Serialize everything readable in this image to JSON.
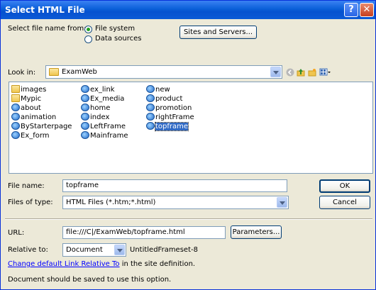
{
  "window": {
    "title": "Select HTML File",
    "help_glyph": "?",
    "close_glyph": "✕"
  },
  "source": {
    "label": "Select file name from:",
    "options": [
      "File system",
      "Data sources"
    ],
    "selected": "File system",
    "sites_button": "Sites and Servers..."
  },
  "lookin": {
    "label": "Look in:",
    "value": "ExamWeb"
  },
  "files": {
    "col1": [
      {
        "name": "images",
        "icon": "folder-icon"
      },
      {
        "name": "Mypic",
        "icon": "folder-icon"
      },
      {
        "name": "about",
        "icon": "ie-icon"
      },
      {
        "name": "animation",
        "icon": "ie-icon"
      },
      {
        "name": "ByStarterpage",
        "icon": "ie-icon"
      },
      {
        "name": "Ex_form",
        "icon": "ie-icon"
      }
    ],
    "col2": [
      {
        "name": "ex_link",
        "icon": "ie-icon"
      },
      {
        "name": "Ex_media",
        "icon": "ie-icon"
      },
      {
        "name": "home",
        "icon": "ie-icon"
      },
      {
        "name": "index",
        "icon": "ie-icon"
      },
      {
        "name": "LeftFrame",
        "icon": "ie-icon"
      },
      {
        "name": "Mainframe",
        "icon": "ie-icon"
      }
    ],
    "col3": [
      {
        "name": "new",
        "icon": "ie-icon"
      },
      {
        "name": "product",
        "icon": "ie-icon"
      },
      {
        "name": "promotion",
        "icon": "ie-icon"
      },
      {
        "name": "rightFrame",
        "icon": "ie-icon"
      },
      {
        "name": "topframe",
        "icon": "ie-icon",
        "selected": true
      }
    ]
  },
  "filename": {
    "label": "File name:",
    "value": "topframe",
    "ok": "OK"
  },
  "filetype": {
    "label": "Files of type:",
    "value": "HTML Files (*.htm;*.html)",
    "cancel": "Cancel"
  },
  "url": {
    "label": "URL:",
    "value": "file:///C|/ExamWeb/topframe.html",
    "params_button": "Parameters..."
  },
  "relative": {
    "label": "Relative to:",
    "value": "Document",
    "doc_name": "UntitledFrameset-8"
  },
  "hint": {
    "link": "Change default Link Relative To",
    "rest": " in the site definition."
  },
  "note": "Document should be saved to use this option."
}
